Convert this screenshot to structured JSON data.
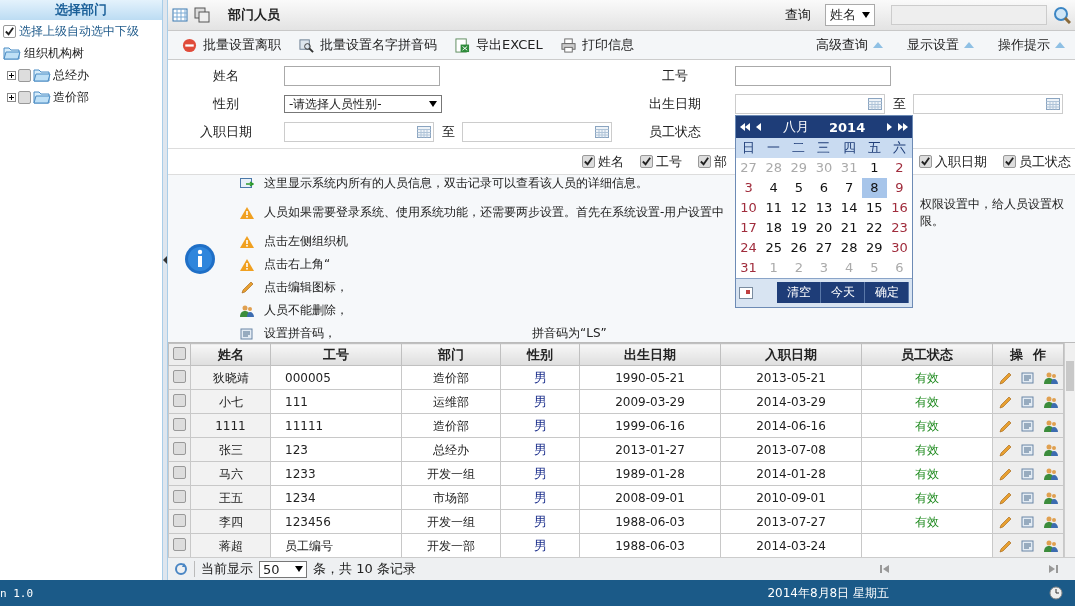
{
  "sidebar": {
    "title": "选择部门",
    "auto_select": {
      "label": "选择上级自动选中下级",
      "checked": true
    },
    "tree": [
      {
        "label": "组织机构树",
        "children": [
          {
            "label": "总经办",
            "expanded": false,
            "checked": false
          },
          {
            "label": "造价部",
            "expanded": false,
            "checked": false
          }
        ]
      }
    ]
  },
  "header": {
    "title": "部门人员",
    "query_label": "查询",
    "query_field": "姓名"
  },
  "toolbar": {
    "actions": [
      {
        "kind": "stop",
        "label": "批量设置离职"
      },
      {
        "kind": "pinyin",
        "label": "批量设置名字拼音码"
      },
      {
        "kind": "excel",
        "label": "导出EXCEL"
      },
      {
        "kind": "print",
        "label": "打印信息"
      }
    ],
    "toggles": [
      "高级查询",
      "显示设置",
      "操作提示"
    ]
  },
  "search_form": {
    "rows": [
      [
        {
          "label": "姓名",
          "kind": "text"
        },
        {
          "label": "工号",
          "kind": "text"
        }
      ],
      [
        {
          "label": "性别",
          "kind": "select",
          "value": "-请选择人员性别-"
        },
        {
          "label": "出生日期",
          "kind": "range",
          "to": "至",
          "picker_open": true
        }
      ],
      [
        {
          "label": "入职日期",
          "kind": "range",
          "to": "至"
        },
        {
          "label": "员工状态",
          "kind": "covered"
        }
      ]
    ]
  },
  "calendar": {
    "month": "八月",
    "year": "2014",
    "weekdays": [
      "日",
      "一",
      "二",
      "三",
      "四",
      "五",
      "六"
    ],
    "weeks": [
      [
        {
          "day": "27",
          "kind": "other",
          "selected": false
        },
        {
          "day": "28",
          "kind": "other",
          "selected": false
        },
        {
          "day": "29",
          "kind": "other",
          "selected": false
        },
        {
          "day": "30",
          "kind": "other",
          "selected": false
        },
        {
          "day": "31",
          "kind": "other",
          "selected": false
        },
        {
          "day": "1",
          "kind": "day",
          "selected": false
        },
        {
          "day": "2",
          "kind": "weekend",
          "selected": false
        }
      ],
      [
        {
          "day": "3",
          "kind": "weekend",
          "selected": false
        },
        {
          "day": "4",
          "kind": "day",
          "selected": false
        },
        {
          "day": "5",
          "kind": "day",
          "selected": false
        },
        {
          "day": "6",
          "kind": "day",
          "selected": false
        },
        {
          "day": "7",
          "kind": "day",
          "selected": false
        },
        {
          "day": "8",
          "kind": "day",
          "selected": true
        },
        {
          "day": "9",
          "kind": "weekend",
          "selected": false
        }
      ],
      [
        {
          "day": "10",
          "kind": "weekend",
          "selected": false
        },
        {
          "day": "11",
          "kind": "day",
          "selected": false
        },
        {
          "day": "12",
          "kind": "day",
          "selected": false
        },
        {
          "day": "13",
          "kind": "day",
          "selected": false
        },
        {
          "day": "14",
          "kind": "day",
          "selected": false
        },
        {
          "day": "15",
          "kind": "day",
          "selected": false
        },
        {
          "day": "16",
          "kind": "weekend",
          "selected": false
        }
      ],
      [
        {
          "day": "17",
          "kind": "weekend",
          "selected": false
        },
        {
          "day": "18",
          "kind": "day",
          "selected": false
        },
        {
          "day": "19",
          "kind": "day",
          "selected": false
        },
        {
          "day": "20",
          "kind": "day",
          "selected": false
        },
        {
          "day": "21",
          "kind": "day",
          "selected": false
        },
        {
          "day": "22",
          "kind": "day",
          "selected": false
        },
        {
          "day": "23",
          "kind": "weekend",
          "selected": false
        }
      ],
      [
        {
          "day": "24",
          "kind": "weekend",
          "selected": false
        },
        {
          "day": "25",
          "kind": "day",
          "selected": false
        },
        {
          "day": "26",
          "kind": "day",
          "selected": false
        },
        {
          "day": "27",
          "kind": "day",
          "selected": false
        },
        {
          "day": "28",
          "kind": "day",
          "selected": false
        },
        {
          "day": "29",
          "kind": "day",
          "selected": false
        },
        {
          "day": "30",
          "kind": "weekend",
          "selected": false
        }
      ],
      [
        {
          "day": "31",
          "kind": "weekend",
          "selected": false
        },
        {
          "day": "1",
          "kind": "other",
          "selected": false
        },
        {
          "day": "2",
          "kind": "other",
          "selected": false
        },
        {
          "day": "3",
          "kind": "other",
          "selected": false
        },
        {
          "day": "4",
          "kind": "other",
          "selected": false
        },
        {
          "day": "5",
          "kind": "other",
          "selected": false
        },
        {
          "day": "6",
          "kind": "other",
          "selected": false
        }
      ]
    ],
    "buttons": [
      "清空",
      "今天",
      "确定"
    ]
  },
  "column_toggles": [
    {
      "label": "姓名",
      "checked": true
    },
    {
      "label": "工号",
      "checked": true
    },
    {
      "label": "部",
      "checked": true
    },
    {
      "label": "入职日期",
      "checked": true
    },
    {
      "label": "员工状态",
      "checked": true
    }
  ],
  "tips": [
    {
      "kind": "arrow",
      "parts": [
        "这里显示系统内所有的人员信息，双击记录可以查看该人员的详细信息。"
      ]
    },
    {
      "kind": "warn",
      "parts": [
        "人员如果需要登录系统、使用系统功能，还需要两步设置。首先在系统设置-用户设置中",
        "权限设置中，给人员设置权限。"
      ]
    },
    {
      "kind": "warn",
      "parts": [
        "点击左侧组织机"
      ]
    },
    {
      "kind": "warn",
      "parts": [
        "点击右上角“"
      ]
    },
    {
      "kind": "pencil",
      "parts": [
        "点击编辑图标，"
      ]
    },
    {
      "kind": "people",
      "parts": [
        "人员不能删除，"
      ]
    },
    {
      "kind": "pinyin",
      "parts": [
        "设置拼音码，",
        "拼音码为“LS”"
      ]
    }
  ],
  "table": {
    "all_checked": false,
    "columns": [
      "姓名",
      "工号",
      "部门",
      "性别",
      "出生日期",
      "入职日期",
      "员工状态",
      "操  作"
    ],
    "rows": [
      {
        "checked": false,
        "name": "狄晓靖",
        "id": "000005",
        "dept": "造价部",
        "sex": "男",
        "birth": "1990-05-21",
        "hired": "2013-05-21",
        "status": "有效"
      },
      {
        "checked": false,
        "name": "小七",
        "id": "111",
        "dept": "运维部",
        "sex": "男",
        "birth": "2009-03-29",
        "hired": "2014-03-29",
        "status": "有效"
      },
      {
        "checked": false,
        "name": "1111",
        "id": "11111",
        "dept": "造价部",
        "sex": "男",
        "birth": "1999-06-16",
        "hired": "2014-06-16",
        "status": "有效"
      },
      {
        "checked": false,
        "name": "张三",
        "id": "123",
        "dept": "总经办",
        "sex": "男",
        "birth": "2013-01-27",
        "hired": "2013-07-08",
        "status": "有效"
      },
      {
        "checked": false,
        "name": "马六",
        "id": "1233",
        "dept": "开发一组",
        "sex": "男",
        "birth": "1989-01-28",
        "hired": "2014-01-28",
        "status": "有效"
      },
      {
        "checked": false,
        "name": "王五",
        "id": "1234",
        "dept": "市场部",
        "sex": "男",
        "birth": "2008-09-01",
        "hired": "2010-09-01",
        "status": "有效"
      },
      {
        "checked": false,
        "name": "李四",
        "id": "123456",
        "dept": "开发一组",
        "sex": "男",
        "birth": "1988-06-03",
        "hired": "2013-07-27",
        "status": "有效"
      },
      {
        "checked": false,
        "name": "蒋超",
        "id": "员工编号",
        "dept": "开发一部",
        "sex": "男",
        "birth": "1988-06-03",
        "hired": "2014-03-24"
      }
    ]
  },
  "pager": {
    "label": "当前显示",
    "page_size": "50",
    "summary": "条，共 10 条记录"
  },
  "status_bar": {
    "version": "n 1.0",
    "date": "2014年8月8日  星期五"
  }
}
